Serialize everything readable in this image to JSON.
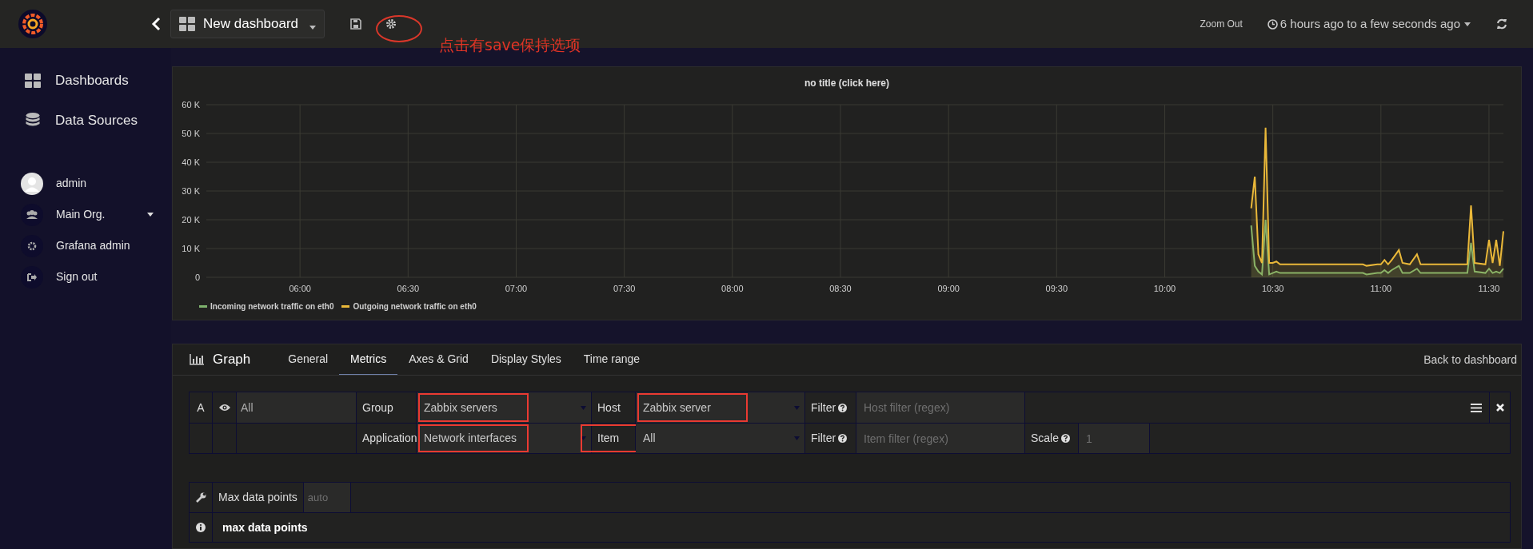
{
  "top_bar": {
    "dashboard_title": "New dashboard",
    "zoom_out": "Zoom Out",
    "time_range": "6 hours ago to a few seconds ago"
  },
  "annotation": {
    "text": "点击有save保持选项"
  },
  "sidebar": {
    "items": [
      {
        "label": "Dashboards",
        "kind": "dashboards"
      },
      {
        "label": "Data Sources",
        "kind": "datasources"
      }
    ],
    "user_menu": [
      {
        "label": "admin",
        "kind": "avatar",
        "dropdown": false
      },
      {
        "label": "Main Org.",
        "kind": "org",
        "dropdown": true
      },
      {
        "label": "Grafana admin",
        "kind": "gear",
        "dropdown": false
      },
      {
        "label": "Sign out",
        "kind": "signout",
        "dropdown": false
      }
    ]
  },
  "panel": {
    "title": "no title (click here)",
    "chart_data": {
      "type": "area",
      "grid": true,
      "x": [
        624,
        625,
        626,
        627,
        628,
        629,
        630,
        631,
        632,
        655,
        656,
        659,
        660,
        661,
        662,
        663,
        665,
        666,
        668,
        670,
        671,
        684,
        685,
        686,
        689,
        690,
        691,
        692,
        693,
        694
      ],
      "series": [
        {
          "name": "Incoming network traffic on eth0",
          "color": "#7eb26d",
          "values": [
            18000,
            4000,
            2000,
            1000,
            20000,
            1000,
            1500,
            2000,
            1500,
            1500,
            1000,
            1500,
            1500,
            2500,
            1500,
            2500,
            4000,
            1500,
            1500,
            3000,
            1500,
            1500,
            12000,
            2000,
            1500,
            3000,
            1500,
            2000,
            1500,
            3000
          ]
        },
        {
          "name": "Outgoing network traffic on eth0",
          "color": "#eab839",
          "values": [
            24000,
            35000,
            8000,
            5000,
            52000,
            5000,
            5000,
            5500,
            4500,
            4500,
            4000,
            4500,
            4500,
            6000,
            4500,
            6000,
            9500,
            5000,
            4500,
            8000,
            4500,
            4500,
            25000,
            5000,
            4500,
            13000,
            5000,
            13000,
            4000,
            16000
          ]
        }
      ],
      "xlim": [
        334,
        694
      ],
      "ylim": [
        0,
        60000
      ],
      "xticks": [
        {
          "value": 360,
          "label": "06:00"
        },
        {
          "value": 390,
          "label": "06:30"
        },
        {
          "value": 420,
          "label": "07:00"
        },
        {
          "value": 450,
          "label": "07:30"
        },
        {
          "value": 480,
          "label": "08:00"
        },
        {
          "value": 510,
          "label": "08:30"
        },
        {
          "value": 540,
          "label": "09:00"
        },
        {
          "value": 570,
          "label": "09:30"
        },
        {
          "value": 600,
          "label": "10:00"
        },
        {
          "value": 630,
          "label": "10:30"
        },
        {
          "value": 660,
          "label": "11:00"
        },
        {
          "value": 690,
          "label": "11:30"
        }
      ],
      "yticks": [
        {
          "value": 0,
          "label": "0"
        },
        {
          "value": 10000,
          "label": "10 K"
        },
        {
          "value": 20000,
          "label": "20 K"
        },
        {
          "value": 30000,
          "label": "30 K"
        },
        {
          "value": 40000,
          "label": "40 K"
        },
        {
          "value": 50000,
          "label": "50 K"
        },
        {
          "value": 60000,
          "label": "60 K"
        }
      ]
    }
  },
  "editor": {
    "title": "Graph",
    "tabs": [
      {
        "label": "General",
        "selected": false
      },
      {
        "label": "Metrics",
        "selected": true
      },
      {
        "label": "Axes & Grid",
        "selected": false
      },
      {
        "label": "Display Styles",
        "selected": false
      },
      {
        "label": "Time range",
        "selected": false
      }
    ],
    "back_link": "Back to dashboard",
    "query_rows": [
      [
        {
          "kind": "ref",
          "text": "A"
        },
        {
          "kind": "eye"
        },
        {
          "kind": "value",
          "text": "All"
        },
        {
          "kind": "label",
          "text": "Group",
          "highlighted": false
        },
        {
          "kind": "select",
          "value": "Zabbix servers",
          "highlighted": true
        },
        {
          "kind": "label",
          "text": "Host",
          "highlighted": false
        },
        {
          "kind": "select",
          "value": "Zabbix server",
          "highlighted": true
        },
        {
          "kind": "label",
          "text": "Filter",
          "help": true,
          "highlighted": false
        },
        {
          "kind": "input",
          "placeholder": "Host filter (regex)"
        },
        {
          "kind": "actions"
        }
      ],
      [
        {
          "kind": "blank"
        },
        {
          "kind": "blank"
        },
        {
          "kind": "blank"
        },
        {
          "kind": "label",
          "text": "Application",
          "highlighted": false
        },
        {
          "kind": "select",
          "value": "Network interfaces",
          "highlighted": true
        },
        {
          "kind": "label",
          "text": "Item",
          "highlighted": true
        },
        {
          "kind": "select",
          "value": "All",
          "highlighted": false
        },
        {
          "kind": "label",
          "text": "Filter",
          "help": true,
          "highlighted": false
        },
        {
          "kind": "input",
          "placeholder": "Item filter (regex)"
        },
        {
          "kind": "label",
          "text": "Scale",
          "help": true,
          "highlighted": false
        },
        {
          "kind": "input",
          "placeholder": "1"
        },
        {
          "kind": "blank"
        }
      ]
    ],
    "options": [
      {
        "kind": "setting",
        "label": "Max data points",
        "placeholder": "auto"
      },
      {
        "kind": "help",
        "label": "max data points"
      }
    ]
  }
}
